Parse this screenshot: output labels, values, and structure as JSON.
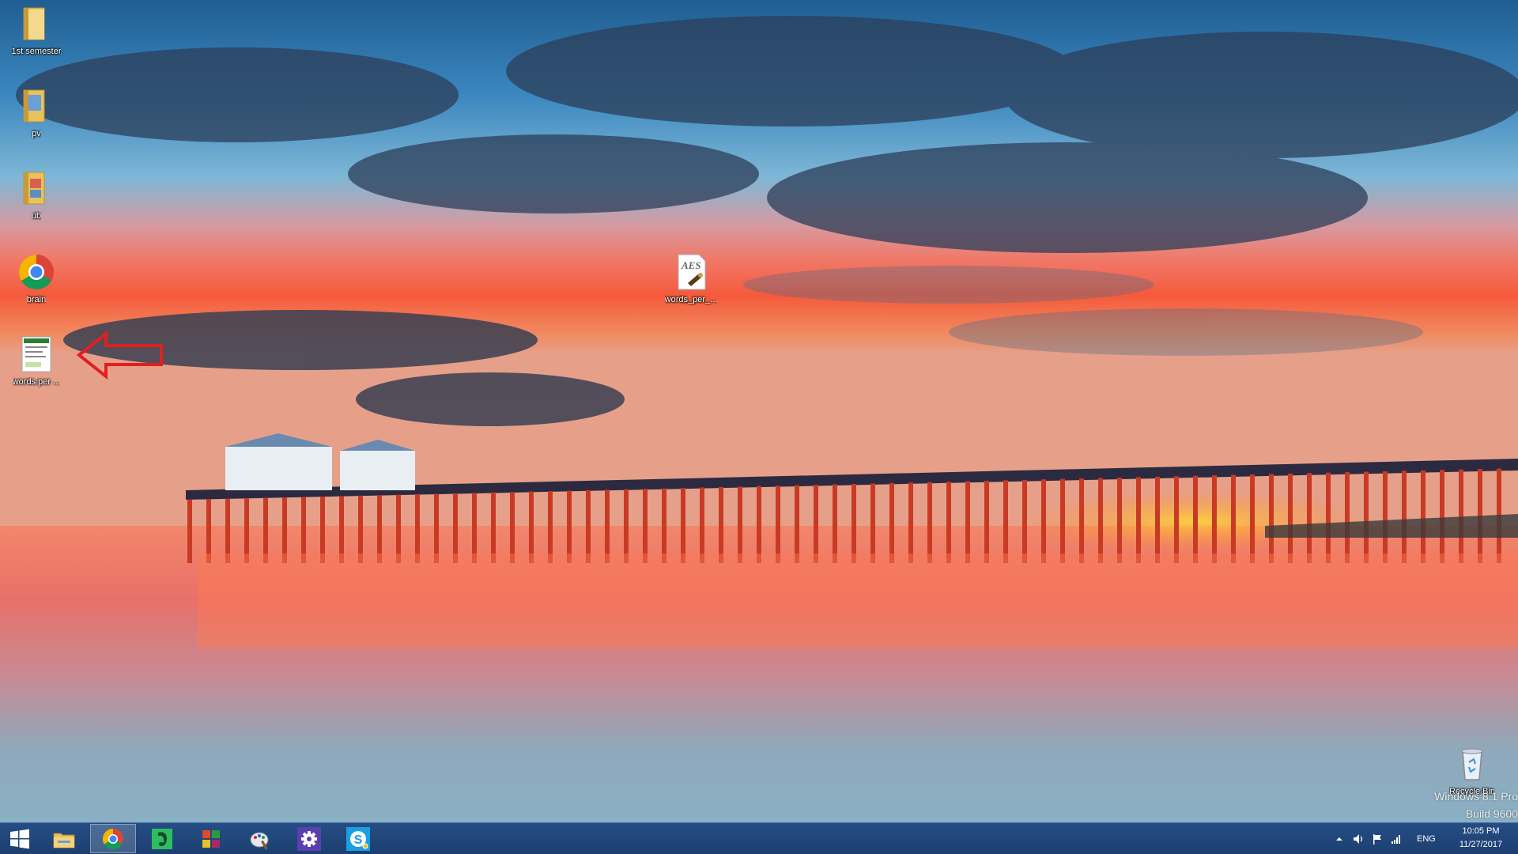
{
  "desktop": {
    "icons": [
      {
        "label": "1st semester",
        "icon": "folder-icon"
      },
      {
        "label": "pv",
        "icon": "folder-icon"
      },
      {
        "label": "ub",
        "icon": "folder-icon"
      },
      {
        "label": "brain",
        "icon": "chrome-icon"
      },
      {
        "label": "words per ...",
        "icon": "document-icon"
      },
      {
        "label": "words_per_...",
        "icon": "aes-file-icon"
      },
      {
        "label": "Recycle Bin",
        "icon": "recycle-bin-icon"
      }
    ],
    "watermark": {
      "line1": "Windows 8.1 Pro",
      "line2": "Build 9600"
    },
    "annotation": "red-arrow-icon"
  },
  "taskbar": {
    "buttons": [
      {
        "name": "start",
        "icon": "windows-logo-icon"
      },
      {
        "name": "file-explorer",
        "icon": "folder-icon"
      },
      {
        "name": "chrome",
        "icon": "chrome-icon",
        "active": true
      },
      {
        "name": "evernote",
        "icon": "evernote-icon"
      },
      {
        "name": "office",
        "icon": "office-icon"
      },
      {
        "name": "paint",
        "icon": "paint-icon"
      },
      {
        "name": "settings",
        "icon": "gear-icon"
      },
      {
        "name": "skype",
        "icon": "skype-icon"
      }
    ],
    "tray": {
      "language": "ENG",
      "time": "10:05 PM",
      "date": "11/27/2017"
    }
  },
  "colors": {
    "taskbar": "#1c3f70",
    "arrow": "#e02020",
    "folder": "#e8c25c",
    "settings": "#5b3fae",
    "skype": "#1aa0e0",
    "evernote": "#2dbe60"
  }
}
